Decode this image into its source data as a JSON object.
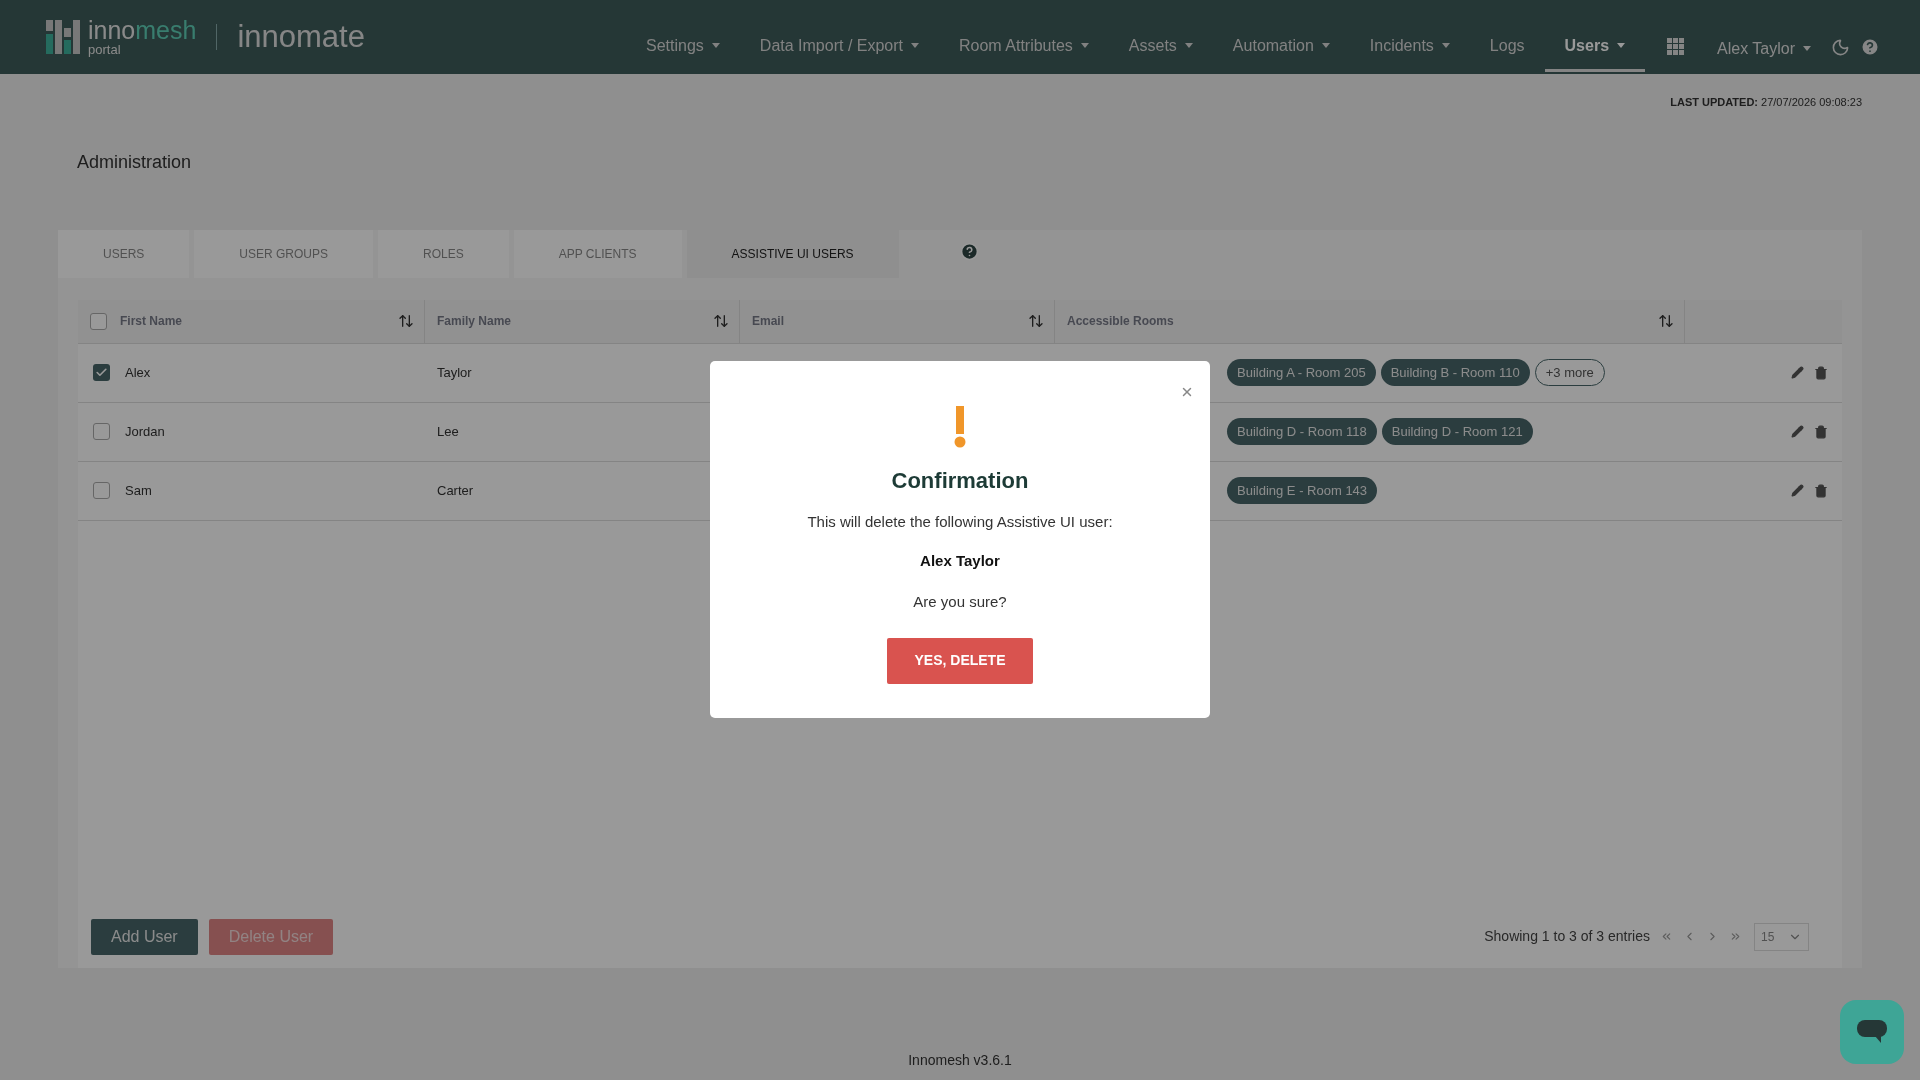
{
  "header": {
    "logo_text": [
      "inno",
      "mesh"
    ],
    "logo_sub": "portal",
    "app_name": "innomate",
    "nav": [
      {
        "label": "Settings",
        "dropdown": true,
        "selected": false
      },
      {
        "label": "Data Import / Export",
        "dropdown": true,
        "selected": false
      },
      {
        "label": "Room Attributes",
        "dropdown": true,
        "selected": false
      },
      {
        "label": "Assets",
        "dropdown": true,
        "selected": false
      },
      {
        "label": "Automation",
        "dropdown": true,
        "selected": false
      },
      {
        "label": "Incidents",
        "dropdown": true,
        "selected": false
      },
      {
        "label": "Logs",
        "dropdown": false,
        "selected": false
      },
      {
        "label": "Users",
        "dropdown": true,
        "selected": true
      }
    ],
    "user": "Alex Taylor"
  },
  "last_updated": "**LAST UPDATED:** 27/07/2026 09:08:23",
  "page_title": "Administration",
  "tabs": [
    {
      "label": "USERS",
      "selected": false
    },
    {
      "label": "USER GROUPS",
      "selected": false
    },
    {
      "label": "ROLES",
      "selected": false
    },
    {
      "label": "APP CLIENTS",
      "selected": false
    },
    {
      "label": "ASSISTIVE UI USERS",
      "selected": true
    }
  ],
  "table": {
    "select_all_checked": false,
    "columns": [
      {
        "label": "First Name"
      },
      {
        "label": "Family Name"
      },
      {
        "label": "Email"
      },
      {
        "label": "Accessible Rooms"
      }
    ],
    "rows": [
      {
        "checked": true,
        "first_name": "Alex",
        "family_name": "Taylor",
        "rooms": [
          "Building A - Room 205",
          "Building B - Room 110"
        ],
        "more": "+3 more"
      },
      {
        "checked": false,
        "first_name": "Jordan",
        "family_name": "Lee",
        "rooms": [
          "Building D - Room 118",
          "Building D - Room 121"
        ]
      },
      {
        "checked": false,
        "first_name": "Sam",
        "family_name": "Carter",
        "rooms": [
          "Building E - Room 143"
        ]
      }
    ]
  },
  "buttons": {
    "add": "Add User",
    "delete": "Delete User"
  },
  "pagination": {
    "summary": "Showing 1 to 3 of 3 entries",
    "page_size": "15"
  },
  "footer": "Innomesh v3.6.1",
  "modal": {
    "title": "Confirmation",
    "message": "This will delete the following Assistive UI user:",
    "user": "Alex Taylor",
    "question": "Are you sure?",
    "confirm": "YES, DELETE"
  }
}
